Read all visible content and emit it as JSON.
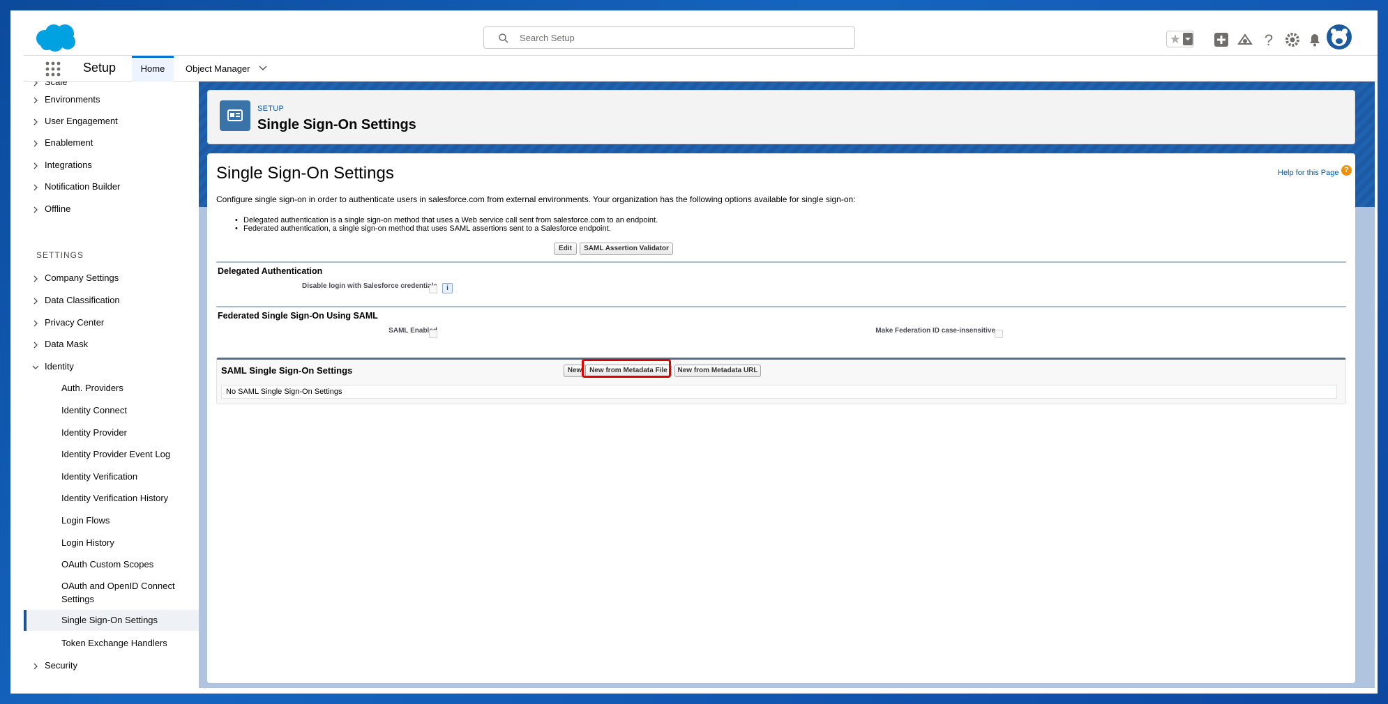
{
  "header": {
    "search_placeholder": "Search Setup",
    "icons": [
      "salesforce-cloud-icon",
      "search-icon",
      "star-icon",
      "add-icon",
      "trailhead-icon",
      "help-icon",
      "gear-icon",
      "bell-icon",
      "avatar"
    ]
  },
  "nav": {
    "app_name": "Setup",
    "tabs": [
      {
        "label": "Home"
      },
      {
        "label": "Object Manager"
      }
    ]
  },
  "sidebar": {
    "top_items": [
      "Scale",
      "Environments",
      "User Engagement",
      "Enablement",
      "Integrations",
      "Notification Builder",
      "Offline"
    ],
    "section_label": "SETTINGS",
    "settings_items": [
      "Company Settings",
      "Data Classification",
      "Privacy Center",
      "Data Mask",
      "Identity"
    ],
    "identity_children": [
      "Auth. Providers",
      "Identity Connect",
      "Identity Provider",
      "Identity Provider Event Log",
      "Identity Verification",
      "Identity Verification History",
      "Login Flows",
      "Login History",
      "OAuth Custom Scopes",
      "OAuth and OpenID Connect Settings",
      "Single Sign-On Settings",
      "Token Exchange Handlers"
    ],
    "selected": "Single Sign-On Settings",
    "bottom_items": [
      "Security"
    ]
  },
  "page_header": {
    "eyebrow": "SETUP",
    "title": "Single Sign-On Settings"
  },
  "content": {
    "title": "Single Sign-On Settings",
    "help_link": "Help for this Page",
    "description": "Configure single sign-on in order to authenticate users in salesforce.com from external environments. Your organization has the following options available for single sign-on:",
    "bullets": [
      "Delegated authentication is a single sign-on method that uses a Web service call sent from salesforce.com to an endpoint.",
      "Federated authentication, a single sign-on method that uses SAML assertions sent to a Salesforce endpoint."
    ],
    "edit_button": "Edit",
    "saml_validator_button": "SAML Assertion Validator",
    "delegated": {
      "title": "Delegated Authentication",
      "field_label": "Disable login with Salesforce credentials",
      "info": "i"
    },
    "federated": {
      "title": "Federated Single Sign-On Using SAML",
      "saml_enabled_label": "SAML Enabled",
      "federation_label": "Make Federation ID case-insensitive"
    },
    "saml_settings": {
      "title": "SAML Single Sign-On Settings",
      "new_button": "New",
      "new_from_file_button": "New from Metadata File",
      "new_from_url_button": "New from Metadata URL",
      "empty_message": "No SAML Single Sign-On Settings"
    }
  },
  "colors": {
    "brand_blue": "#0176d3",
    "highlight_red": "#e00000",
    "background": "#0d47a1"
  }
}
